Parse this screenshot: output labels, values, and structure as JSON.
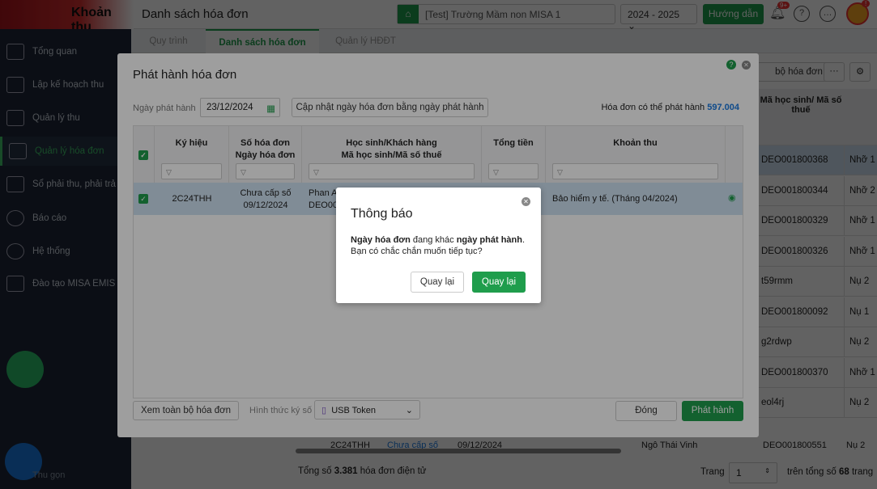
{
  "header": {
    "app_title": "Khoản thu",
    "page_title": "Danh sách hóa đơn",
    "school": "[Test] Trường Mầm non MISA 1",
    "year": "2024 - 2025",
    "guide_label": "Hướng dẫn",
    "notif_badge": "9+",
    "avatar_badge": "!"
  },
  "sidebar": {
    "items": [
      {
        "label": "Tổng quan"
      },
      {
        "label": "Lập kế hoạch thu"
      },
      {
        "label": "Quản lý thu"
      },
      {
        "label": "Quản lý hóa đơn"
      },
      {
        "label": "Sổ phải thu, phải trả"
      },
      {
        "label": "Báo cáo"
      },
      {
        "label": "Hệ thống"
      },
      {
        "label": "Đào tạo MISA EMIS"
      }
    ],
    "collapse_label": "Thu gọn"
  },
  "tabs": [
    {
      "label": "Quy trình"
    },
    {
      "label": "Danh sách hóa đơn"
    },
    {
      "label": "Quản lý HĐĐT"
    }
  ],
  "background": {
    "view_all_label": "bộ hóa đơn",
    "col_header": "Mã học sinh/ Mã số thuế",
    "rows": [
      {
        "code": "DEO001800368",
        "c2": "Nhỡ 1"
      },
      {
        "code": "DEO001800344",
        "c2": "Nhỡ 2"
      },
      {
        "code": "DEO001800329",
        "c2": "Nhỡ 1"
      },
      {
        "code": "DEO001800326",
        "c2": "Nhỡ 1"
      },
      {
        "code": "t59rmm",
        "c2": "Nụ 2"
      },
      {
        "code": "DEO001800092",
        "c2": "Nụ 1"
      },
      {
        "code": "g2rdwp",
        "c2": "Nụ 2"
      },
      {
        "code": "DEO001800370",
        "c2": "Nhỡ 1"
      },
      {
        "code": "eol4rj",
        "c2": "Nụ 2"
      }
    ],
    "last_row": {
      "symbol": "2C24THH",
      "number": "Chưa cấp số",
      "date": "09/12/2024",
      "name": "Ngô Thái Vinh",
      "code": "DEO001800551",
      "c2": "Nụ 2"
    },
    "total_prefix": "Tổng số",
    "total_count": "3.381",
    "total_suffix": "hóa đơn điện tử",
    "page_label": "Trang",
    "page_value": "1",
    "page_total_prefix": "trên tổng số",
    "page_total": "68",
    "page_total_suffix": "trang"
  },
  "modal": {
    "title": "Phát hành hóa đơn",
    "date_label": "Ngày phát hành",
    "date_value": "23/12/2024",
    "update_button": "Cập nhật ngày hóa đơn bằng ngày phát hành",
    "available_label": "Hóa đơn có thể phát hành",
    "available_count": "597.004",
    "columns": {
      "symbol": "Ký hiệu",
      "number": "Số hóa đơn\nNgày hóa đơn",
      "student": "Học sinh/Khách hàng\nMã học sinh/Mã số thuế",
      "total": "Tổng tiền",
      "fee": "Khoản thu"
    },
    "row": {
      "symbol": "2C24THH",
      "number": "Chưa cấp số",
      "date": "09/12/2024",
      "name": "Phan A",
      "code": "DEO00",
      "fee": "Bảo hiểm y tế. (Tháng 04/2024)"
    },
    "view_all_button": "Xem toàn bộ hóa đơn",
    "sign_method_label": "Hình thức ký số",
    "sign_method_value": "USB Token",
    "close_button": "Đóng",
    "issue_button": "Phát hành"
  },
  "dialog": {
    "title": "Thông báo",
    "msg_b1": "Ngày hóa đơn",
    "msg_t1": " đang khác ",
    "msg_b2": "ngày phát hành",
    "msg_t2": ".",
    "msg_line2": "Bạn có chắc chắn muốn tiếp tục?",
    "back_button": "Quay lại",
    "confirm_button": "Quay lại"
  }
}
